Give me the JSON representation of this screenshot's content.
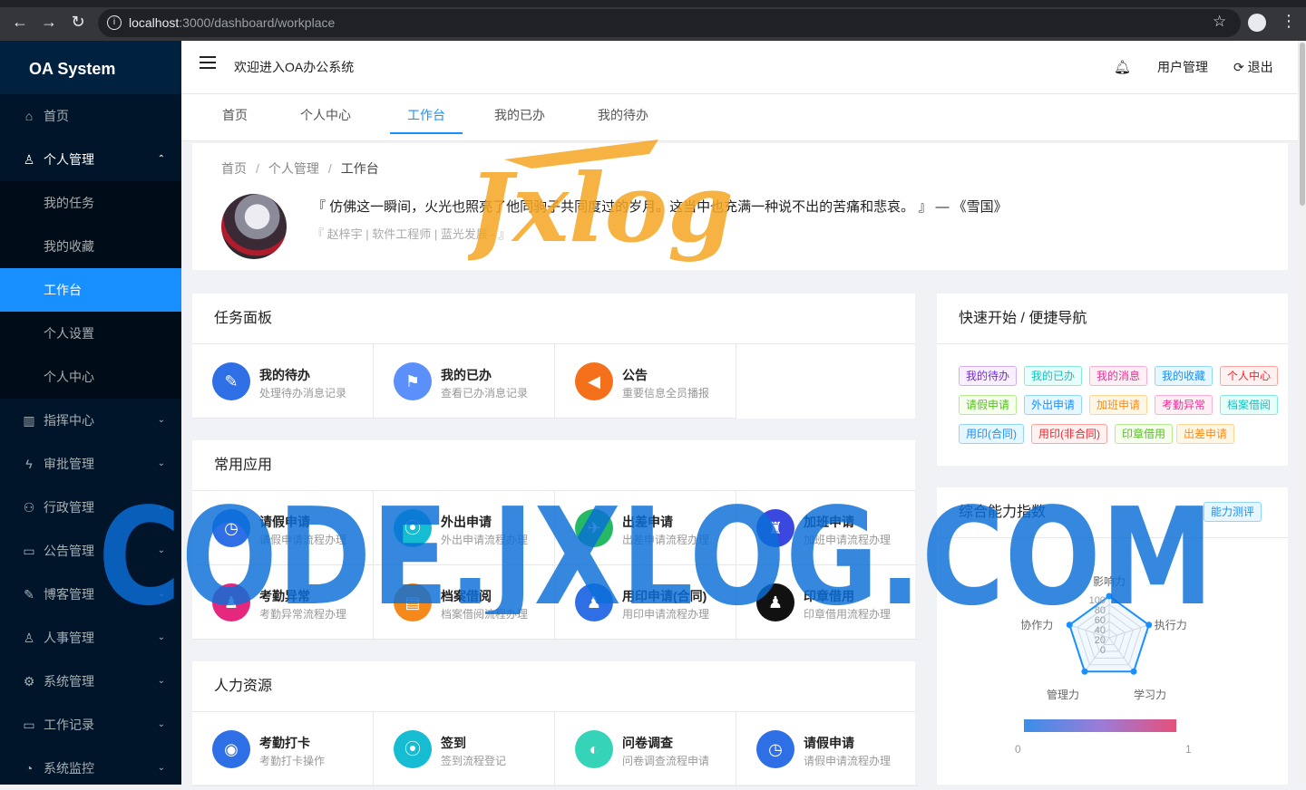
{
  "browser": {
    "url_host": "localhost",
    "url_path": ":3000/dashboard/workplace"
  },
  "sidebar": {
    "logo": "OA System",
    "items": [
      {
        "label": "首页",
        "icon": "home-icon"
      },
      {
        "label": "个人管理",
        "icon": "user-icon",
        "open": true,
        "children": [
          "我的任务",
          "我的收藏",
          "工作台",
          "个人设置",
          "个人中心"
        ]
      },
      {
        "label": "指挥中心",
        "icon": "chart-icon"
      },
      {
        "label": "审批管理",
        "icon": "lightning-icon"
      },
      {
        "label": "行政管理",
        "icon": "team-icon"
      },
      {
        "label": "公告管理",
        "icon": "notice-icon"
      },
      {
        "label": "博客管理",
        "icon": "edit-icon"
      },
      {
        "label": "人事管理",
        "icon": "people-icon"
      },
      {
        "label": "系统管理",
        "icon": "settings-icon"
      },
      {
        "label": "工作记录",
        "icon": "laptop-icon"
      },
      {
        "label": "系统监控",
        "icon": "dashboard-icon"
      }
    ],
    "active_child": "工作台"
  },
  "header": {
    "welcome": "欢迎进入OA办公系统",
    "user_mgmt": "用户管理",
    "logout": "退出"
  },
  "tabs": [
    "首页",
    "个人中心",
    "工作台",
    "我的已办",
    "我的待办"
  ],
  "active_tab": "工作台",
  "profile": {
    "breadcrumb": [
      "首页",
      "个人管理",
      "工作台"
    ],
    "quote": "『 仿佛这一瞬间，火光也照亮了他同驹子共同度过的岁月。这当中也充满一种说不出的苦痛和悲哀。 』 — 《雪国》",
    "signature": "『 赵梓宇 | 软件工程师 | 蓝光发展 - 』"
  },
  "task_panel": {
    "title": "任务面板",
    "items": [
      {
        "title": "我的待办",
        "sub": "处理待办消息记录",
        "color": "#2f6fe6",
        "icon": "pencil-icon"
      },
      {
        "title": "我的已办",
        "sub": "查看已办消息记录",
        "color": "#5b8ff9",
        "icon": "flag-icon"
      },
      {
        "title": "公告",
        "sub": "重要信息全员播报",
        "color": "#f5701a",
        "icon": "speaker-icon"
      }
    ]
  },
  "common_apps": {
    "title": "常用应用",
    "items": [
      {
        "title": "请假申请",
        "sub": "请假申请流程办理",
        "color": "#2f6fe6",
        "icon": "clock-icon"
      },
      {
        "title": "外出申请",
        "sub": "外出申请流程办理",
        "color": "#15bcd2",
        "icon": "location-icon"
      },
      {
        "title": "出差申请",
        "sub": "出差申请流程办理",
        "color": "#25b865",
        "icon": "plane-icon"
      },
      {
        "title": "加班申请",
        "sub": "加班申请流程办理",
        "color": "#3a48e0",
        "icon": "lamp-icon"
      },
      {
        "title": "考勤异常",
        "sub": "考勤异常流程办理",
        "color": "#e6277e",
        "icon": "person-icon"
      },
      {
        "title": "档案借阅",
        "sub": "档案借阅流程办理",
        "color": "#f58a1a",
        "icon": "archive-icon"
      },
      {
        "title": "用印申请(合同)",
        "sub": "用印申请流程办理",
        "color": "#2f6fe6",
        "icon": "stamp-icon"
      },
      {
        "title": "印章借用",
        "sub": "印章借用流程办理",
        "color": "#111111",
        "icon": "seal-icon"
      }
    ]
  },
  "hr": {
    "title": "人力资源",
    "items": [
      {
        "title": "考勤打卡",
        "sub": "考勤打卡操作",
        "color": "#2f6fe6",
        "icon": "checkin-icon"
      },
      {
        "title": "签到",
        "sub": "签到流程登记",
        "color": "#15bcd2",
        "icon": "sign-icon"
      },
      {
        "title": "问卷调查",
        "sub": "问卷调查流程申请",
        "color": "#35d4b8",
        "icon": "survey-icon"
      },
      {
        "title": "请假申请",
        "sub": "请假申请流程办理",
        "color": "#2f6fe6",
        "icon": "clock-icon"
      }
    ]
  },
  "quick_nav": {
    "title": "快速开始 / 便捷导航",
    "tags": [
      {
        "label": "我的待办",
        "color": "#722ed1",
        "bg": "#f9f0ff",
        "bd": "#d3adf7"
      },
      {
        "label": "我的已办",
        "color": "#13c2c2",
        "bg": "#e6fffb",
        "bd": "#87e8de"
      },
      {
        "label": "我的消息",
        "color": "#eb2f96",
        "bg": "#fff0f6",
        "bd": "#ffadd2"
      },
      {
        "label": "我的收藏",
        "color": "#1890ff",
        "bg": "#e6f7ff",
        "bd": "#91d5ff"
      },
      {
        "label": "个人中心",
        "color": "#f5222d",
        "bg": "#fff1f0",
        "bd": "#ffa39e"
      },
      {
        "label": "请假申请",
        "color": "#52c41a",
        "bg": "#f6ffed",
        "bd": "#b7eb8f"
      },
      {
        "label": "外出申请",
        "color": "#1890ff",
        "bg": "#e6f7ff",
        "bd": "#91d5ff"
      },
      {
        "label": "加班申请",
        "color": "#fa8c16",
        "bg": "#fff7e6",
        "bd": "#ffd591"
      },
      {
        "label": "考勤异常",
        "color": "#eb2f96",
        "bg": "#fff0f6",
        "bd": "#ffadd2"
      },
      {
        "label": "档案借阅",
        "color": "#13c2c2",
        "bg": "#e6fffb",
        "bd": "#87e8de"
      },
      {
        "label": "用印(合同)",
        "color": "#1890ff",
        "bg": "#e6f7ff",
        "bd": "#91d5ff"
      },
      {
        "label": "用印(非合同)",
        "color": "#f5222d",
        "bg": "#fff1f0",
        "bd": "#ffa39e"
      },
      {
        "label": "印章借用",
        "color": "#52c41a",
        "bg": "#f6ffed",
        "bd": "#b7eb8f"
      },
      {
        "label": "出差申请",
        "color": "#fa8c16",
        "bg": "#fff7e6",
        "bd": "#ffd591"
      }
    ]
  },
  "ability": {
    "title": "综合能力指数",
    "button": "能力测评",
    "axes": [
      "影响力",
      "执行力",
      "学习力",
      "管理力",
      "协作力"
    ],
    "ticks": [
      "100",
      "80",
      "60",
      "40",
      "20",
      "0"
    ],
    "visual_min": "0",
    "visual_max": "1"
  },
  "watermarks": {
    "top": "Jxlog",
    "bottom": "CODE.JXLOG.COM"
  }
}
